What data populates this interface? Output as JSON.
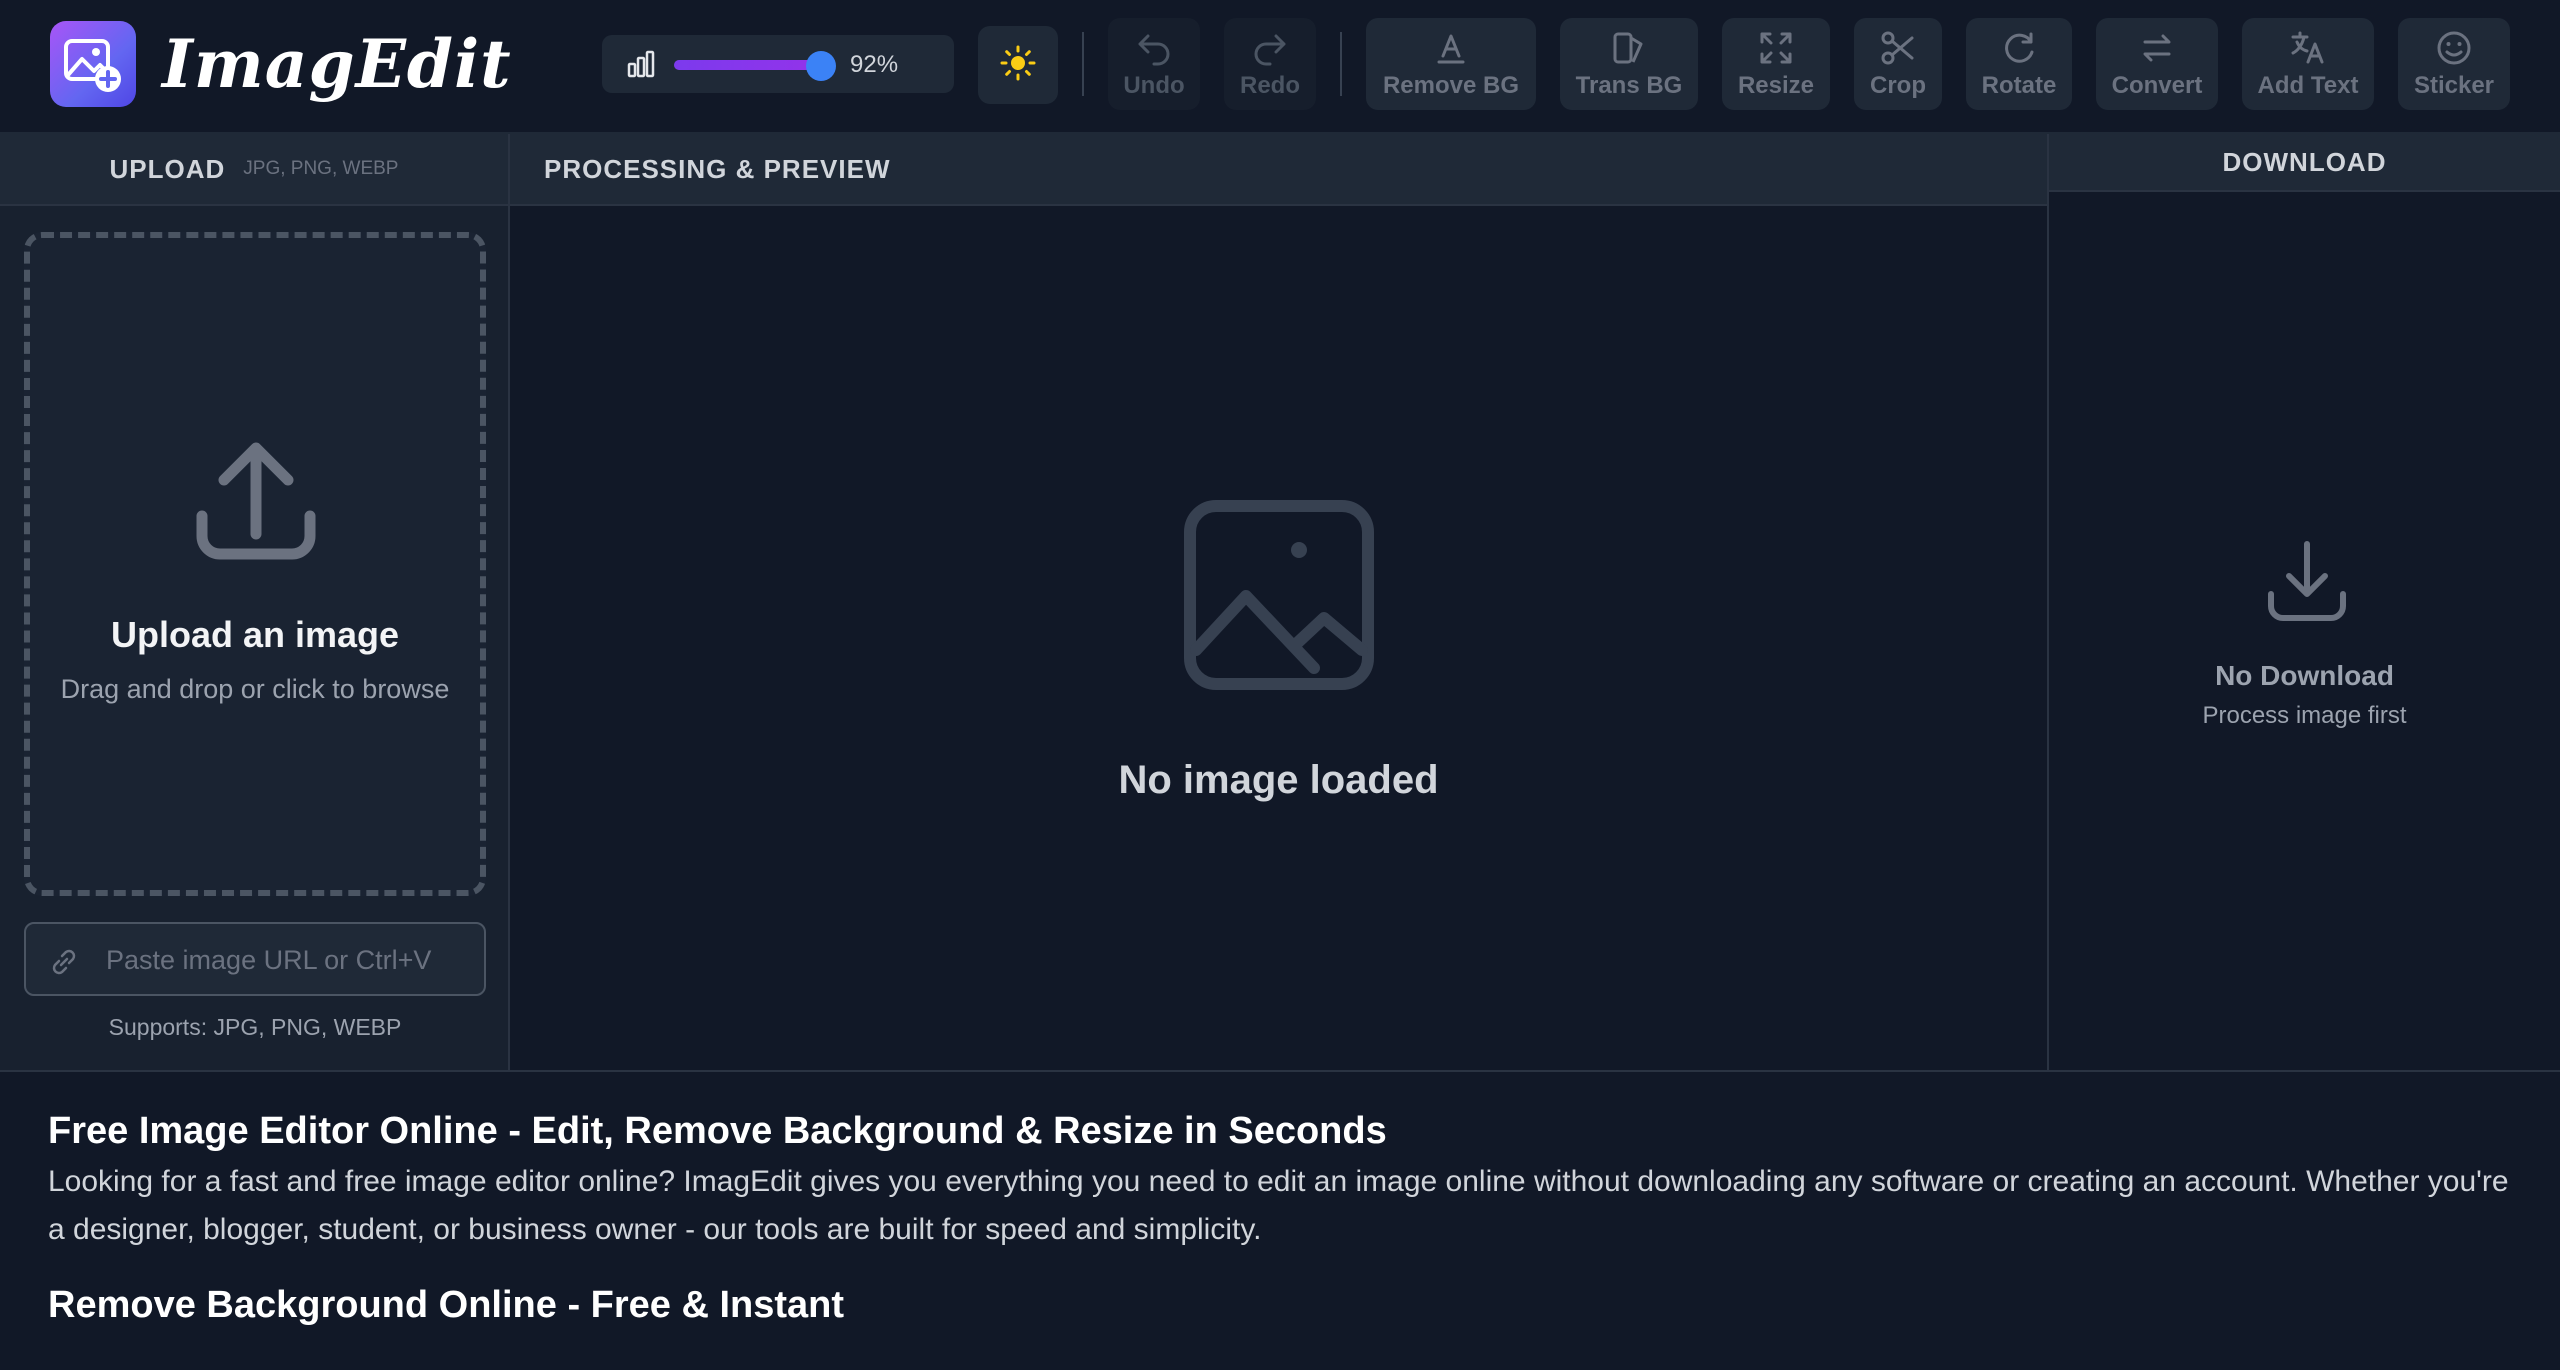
{
  "app": {
    "name": "ImagEdit"
  },
  "toolbar": {
    "zoom_value": "92%",
    "zoom_fraction": 0.92,
    "tools": [
      {
        "label": "Undo",
        "icon": "undo-icon",
        "disabled": true
      },
      {
        "label": "Redo",
        "icon": "redo-icon",
        "disabled": true
      },
      {
        "label": "Remove BG",
        "icon": "eraser-icon",
        "disabled": false
      },
      {
        "label": "Trans BG",
        "icon": "transparency-icon",
        "disabled": false
      },
      {
        "label": "Resize",
        "icon": "resize-icon",
        "disabled": false
      },
      {
        "label": "Crop",
        "icon": "scissors-icon",
        "disabled": false
      },
      {
        "label": "Rotate",
        "icon": "rotate-icon",
        "disabled": false
      },
      {
        "label": "Convert",
        "icon": "convert-icon",
        "disabled": false
      },
      {
        "label": "Add Text",
        "icon": "translate-icon",
        "disabled": false
      },
      {
        "label": "Sticker",
        "icon": "smiley-icon",
        "disabled": false
      }
    ]
  },
  "upload": {
    "header": "UPLOAD",
    "header_formats": "JPG, PNG, WEBP",
    "title": "Upload an image",
    "subtitle": "Drag and drop or click to browse",
    "url_placeholder": "Paste image URL or Ctrl+V",
    "supports": "Supports: JPG, PNG, WEBP"
  },
  "preview": {
    "header": "PROCESSING & PREVIEW",
    "empty_text": "No image loaded"
  },
  "download": {
    "header": "DOWNLOAD",
    "title": "No Download",
    "subtitle": "Process image first"
  },
  "content": {
    "heading1": "Free Image Editor Online - Edit, Remove Background & Resize in Seconds",
    "paragraph1": "Looking for a fast and free image editor online? ImagEdit gives you everything you need to edit an image online without downloading any software or creating an account. Whether you're a designer, blogger, student, or business owner - our tools are built for speed and simplicity.",
    "heading2": "Remove Background Online - Free & Instant"
  },
  "colors": {
    "background": "#111827",
    "panel": "#1f2937",
    "accent_purple": "#7c3aed",
    "accent_blue": "#3b82f6",
    "sun_yellow": "#facc15"
  }
}
